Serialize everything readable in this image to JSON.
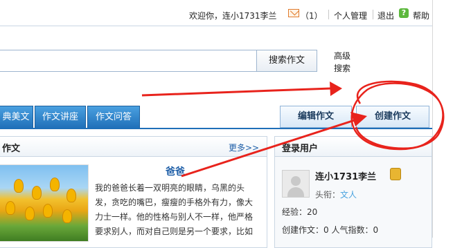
{
  "topbar": {
    "welcome": "欢迎你，连小1731李兰",
    "mail_count": "（1）",
    "personal_manage": "个人管理",
    "logout": "退出",
    "help": "帮助"
  },
  "search": {
    "button_label": "搜索作文",
    "advanced_label": "高级搜索"
  },
  "tabs": [
    "典美文",
    "作文讲座",
    "作文问答"
  ],
  "actions": {
    "edit_label": "编辑作文",
    "create_label": "创建作文"
  },
  "article_panel": {
    "title": "作文",
    "more_label": "更多>>",
    "article_title": "爸爸",
    "article_body": "我的爸爸长着一双明亮的眼睛，乌黑的头发，贪吃的嘴巴，瘦瘦的手格外有力，像大力士一样。他的性格与别人不一样，他严格要求别人，而对自己则是另一个要求，比如"
  },
  "login_panel": {
    "title": "登录用户",
    "user_name": "连小1731李兰",
    "title_label": "头衔：",
    "title_value": "文人",
    "experience": "经验：20",
    "stats": "创建作文：0  人气指数：0"
  },
  "colors": {
    "tab_blue": "#1f6fb8",
    "link_blue": "#1f5fa8",
    "annotation_red": "#e8231c"
  }
}
